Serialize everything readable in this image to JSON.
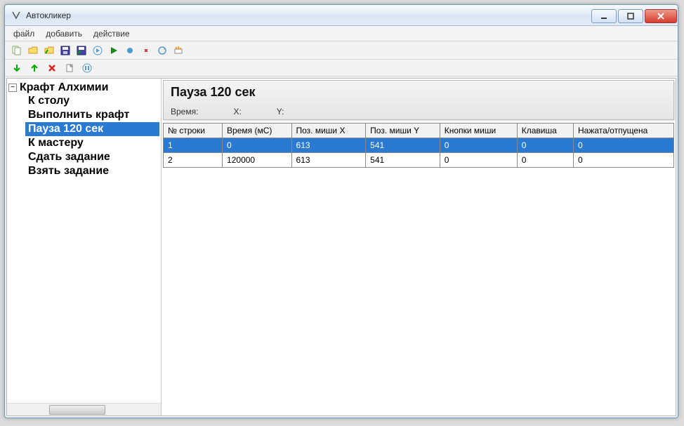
{
  "window": {
    "title": "Автокликер"
  },
  "menu": {
    "file": "файл",
    "add": "добавить",
    "action": "действие"
  },
  "tree": {
    "root": "Крафт Алхимии",
    "items": [
      {
        "label": "К столу",
        "selected": false
      },
      {
        "label": "Выполнить крафт",
        "selected": false
      },
      {
        "label": "Пауза 120 сек",
        "selected": true
      },
      {
        "label": "К мастеру",
        "selected": false
      },
      {
        "label": "Сдать задание",
        "selected": false
      },
      {
        "label": "Взять задание",
        "selected": false
      }
    ]
  },
  "details": {
    "title": "Пауза 120 сек",
    "time_label": "Время:",
    "x_label": "X:",
    "y_label": "Y:"
  },
  "table": {
    "headers": [
      "№ строки",
      "Время (мС)",
      "Поз. миши X",
      "Поз. миши Y",
      "Кнопки миши",
      "Клавиша",
      "Нажата/отпущена"
    ],
    "rows": [
      {
        "cells": [
          "1",
          "0",
          "613",
          "541",
          "0",
          "0",
          "0"
        ],
        "selected": true
      },
      {
        "cells": [
          "2",
          "120000",
          "613",
          "541",
          "0",
          "0",
          "0"
        ],
        "selected": false
      }
    ]
  }
}
